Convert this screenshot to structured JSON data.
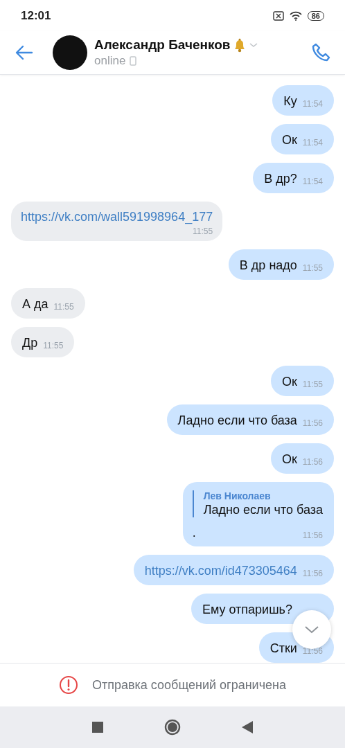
{
  "status_bar": {
    "time": "12:01",
    "battery": "86"
  },
  "header": {
    "name": "Александр Баченков",
    "presence": "online",
    "muted_bell": true
  },
  "messages": [
    {
      "kind": "text",
      "outgoing": true,
      "text": "Ку",
      "time": "11:54"
    },
    {
      "kind": "text",
      "outgoing": true,
      "text": "Ок",
      "time": "11:54"
    },
    {
      "kind": "text",
      "outgoing": true,
      "text": "В др?",
      "time": "11:54"
    },
    {
      "kind": "link",
      "outgoing": false,
      "text": "https://vk.com/wall591998964_177",
      "time": "11:55"
    },
    {
      "kind": "text",
      "outgoing": true,
      "text": "В др надо",
      "time": "11:55"
    },
    {
      "kind": "text",
      "outgoing": false,
      "text": "А да",
      "time": "11:55"
    },
    {
      "kind": "text",
      "outgoing": false,
      "text": "Др",
      "time": "11:55"
    },
    {
      "kind": "text",
      "outgoing": true,
      "text": "Ок",
      "time": "11:55"
    },
    {
      "kind": "text",
      "outgoing": true,
      "text": "Ладно если что база",
      "time": "11:56"
    },
    {
      "kind": "text",
      "outgoing": true,
      "text": "Ок",
      "time": "11:56"
    },
    {
      "kind": "reply",
      "outgoing": true,
      "reply_author": "Лев Николаев",
      "reply_text": "Ладно если что база",
      "text": ".",
      "time": "11:56"
    },
    {
      "kind": "inlink",
      "outgoing": true,
      "text": "https://vk.com/id473305464",
      "time": "11:56"
    },
    {
      "kind": "text",
      "outgoing": true,
      "text": "Ему отпаришь?"
    },
    {
      "kind": "text",
      "outgoing": true,
      "text": "Стки",
      "time": "11:56"
    }
  ],
  "notice": "Отправка сообщений ограничена"
}
